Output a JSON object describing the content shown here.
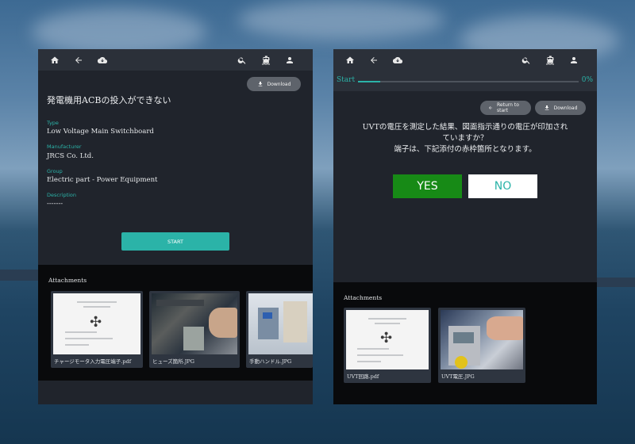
{
  "left_panel": {
    "toolbar": {
      "home_icon": "home-icon",
      "back_icon": "arrow-left-icon",
      "cloud_icon": "cloud-download-icon",
      "search_icon": "search-icon",
      "ship_icon": "ship-icon",
      "user_icon": "user-icon"
    },
    "download_label": "Download",
    "title": "発電機用ACBの投入ができない",
    "fields": [
      {
        "label": "Type",
        "value": "Low Voltage Main Switchboard"
      },
      {
        "label": "Manufacturer",
        "value": "JRCS Co. Ltd."
      },
      {
        "label": "Group",
        "value": "Electric part - Power Equipment"
      },
      {
        "label": "Description",
        "value": "-------"
      }
    ],
    "start_label": "START",
    "attachments_title": "Attachments",
    "attachments": [
      {
        "name": "チャージモータ入力電圧端子.pdf",
        "kind": "pdf"
      },
      {
        "name": "ヒューズ箇所.JPG",
        "kind": "photo"
      },
      {
        "name": "手動ハンドル.JPG",
        "kind": "photo"
      }
    ]
  },
  "right_panel": {
    "progress": {
      "start_label": "Start",
      "percent_label": "0%",
      "fill_fraction": 0.1
    },
    "return_label": "Return to start",
    "download_label": "Download",
    "question_line1": "UVTの電圧を測定した結果、図面指示通りの電圧が印加され",
    "question_line2": "ていますか？",
    "question_line3": "端子は、下記添付の赤枠箇所となります。",
    "yes_label": "YES",
    "no_label": "NO",
    "attachments_title": "Attachments",
    "attachments": [
      {
        "name": "UVT回路.pdf",
        "kind": "pdf"
      },
      {
        "name": "UVT電圧.JPG",
        "kind": "photo"
      }
    ]
  },
  "colors": {
    "accent": "#2bb3a8",
    "yes": "#178a16",
    "panel": "#20242c",
    "toolbar": "#2b3039"
  }
}
